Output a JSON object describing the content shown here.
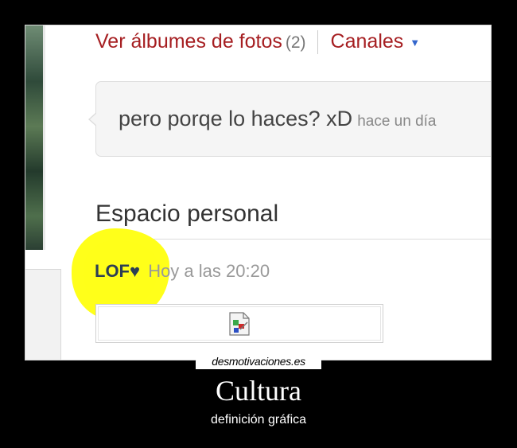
{
  "menu": {
    "albums_label": "Ver álbumes de fotos",
    "albums_count": "(2)",
    "channels_label": "Canales"
  },
  "comment": {
    "text": "pero porqe lo haces? xD",
    "time": "hace un día"
  },
  "section": {
    "title": "Espacio personal"
  },
  "post": {
    "author": "LOF♥",
    "time": "Hoy a las 20:20"
  },
  "poster": {
    "site": "desmotivaciones.es",
    "title": "Cultura",
    "subtitle": "definición gráfica"
  },
  "colors": {
    "link": "#a61f22",
    "highlight": "#ffff1a",
    "background": "#000000"
  }
}
